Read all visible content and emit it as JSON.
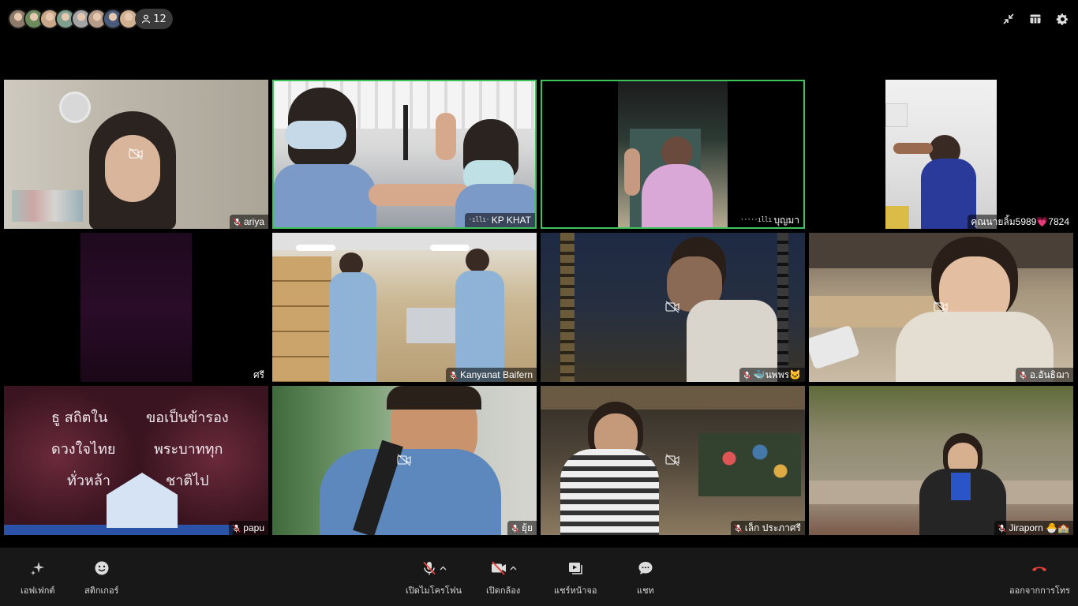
{
  "participants_bar": {
    "count": "12",
    "avatar_colors": [
      "#8c7a6b",
      "#6d8a5c",
      "#c9a88a",
      "#7f9f8e",
      "#a4a4a4",
      "#b89c8a",
      "#4a5a7a",
      "#d0b090"
    ]
  },
  "top_icons": [
    "minimize-icon",
    "grid-layout-icon",
    "settings-gear-icon"
  ],
  "tiles": [
    {
      "name": "ariya",
      "bg": "#b7b1a3",
      "muted": true
    },
    {
      "name": "KP KHAT",
      "bg": "#8c9aa8",
      "speaking": true
    },
    {
      "name": "บุญมา",
      "bg": "#1a1a1a",
      "speaking": true
    },
    {
      "name": "คุณนายลิ้ม5989💗7824",
      "bg": "#000000",
      "muted": false
    },
    {
      "name": "ศรี",
      "bg": "#000000",
      "muted": false
    },
    {
      "name": "Kanyanat Baifern",
      "bg": "#b9a98c",
      "muted": true
    },
    {
      "name": "🐳นพพร🐱",
      "bg": "#1d2433",
      "muted": true
    },
    {
      "name": "อ.อันธิฌา",
      "bg": "#a79a8a",
      "muted": true
    },
    {
      "name": "papu",
      "bg": "#3a1520",
      "muted": true,
      "card_text": [
        "ธู สถิตใน",
        "ขอเป็นข้ารอง",
        "ดวงใจไทย",
        "พระบาททุก",
        "ทั่วหล้า",
        "ชาติไป"
      ]
    },
    {
      "name": "ยุ้ย",
      "bg": "#5f7f6a",
      "muted": true
    },
    {
      "name": "เล็ก ประภาศรี",
      "bg": "#4a3f33",
      "muted": true
    },
    {
      "name": "Jiraporn 🐣🏫",
      "bg": "#6f6a55",
      "muted": true
    }
  ],
  "controls": {
    "effects": "เอฟเฟกต์",
    "stickers": "สติกเกอร์",
    "microphone": "เปิดไมโครโฟน",
    "camera": "เปิดกล้อง",
    "share": "แชร์หน้าจอ",
    "chat": "แชท",
    "leave": "ออกจากการโทร"
  },
  "colors": {
    "speaking_border": "#3ec25a",
    "leave_red": "#e8413b",
    "bottom_bar": "#181818"
  }
}
